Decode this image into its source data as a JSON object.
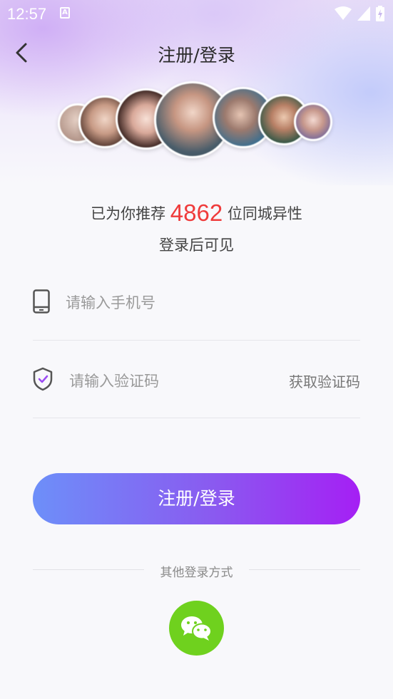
{
  "status_bar": {
    "time": "12:57",
    "notification_glyph": "A",
    "icons": [
      "wifi-icon",
      "signal-icon",
      "battery-charging-icon"
    ]
  },
  "header": {
    "title": "注册/登录",
    "back_icon": "chevron-left-icon"
  },
  "recommendation": {
    "prefix": "已为你推荐",
    "count": "4862",
    "suffix": "位同城异性",
    "subtitle": "登录后可见"
  },
  "form": {
    "phone_placeholder": "请输入手机号",
    "code_placeholder": "请输入验证码",
    "get_code_label": "获取验证码",
    "submit_label": "注册/登录"
  },
  "other_login": {
    "label": "其他登录方式",
    "methods": [
      "wechat-icon"
    ]
  },
  "colors": {
    "accent_start": "#6d8ff9",
    "accent_end": "#a51ff4",
    "highlight": "#ef3b3b",
    "wechat": "#6fd11e"
  }
}
